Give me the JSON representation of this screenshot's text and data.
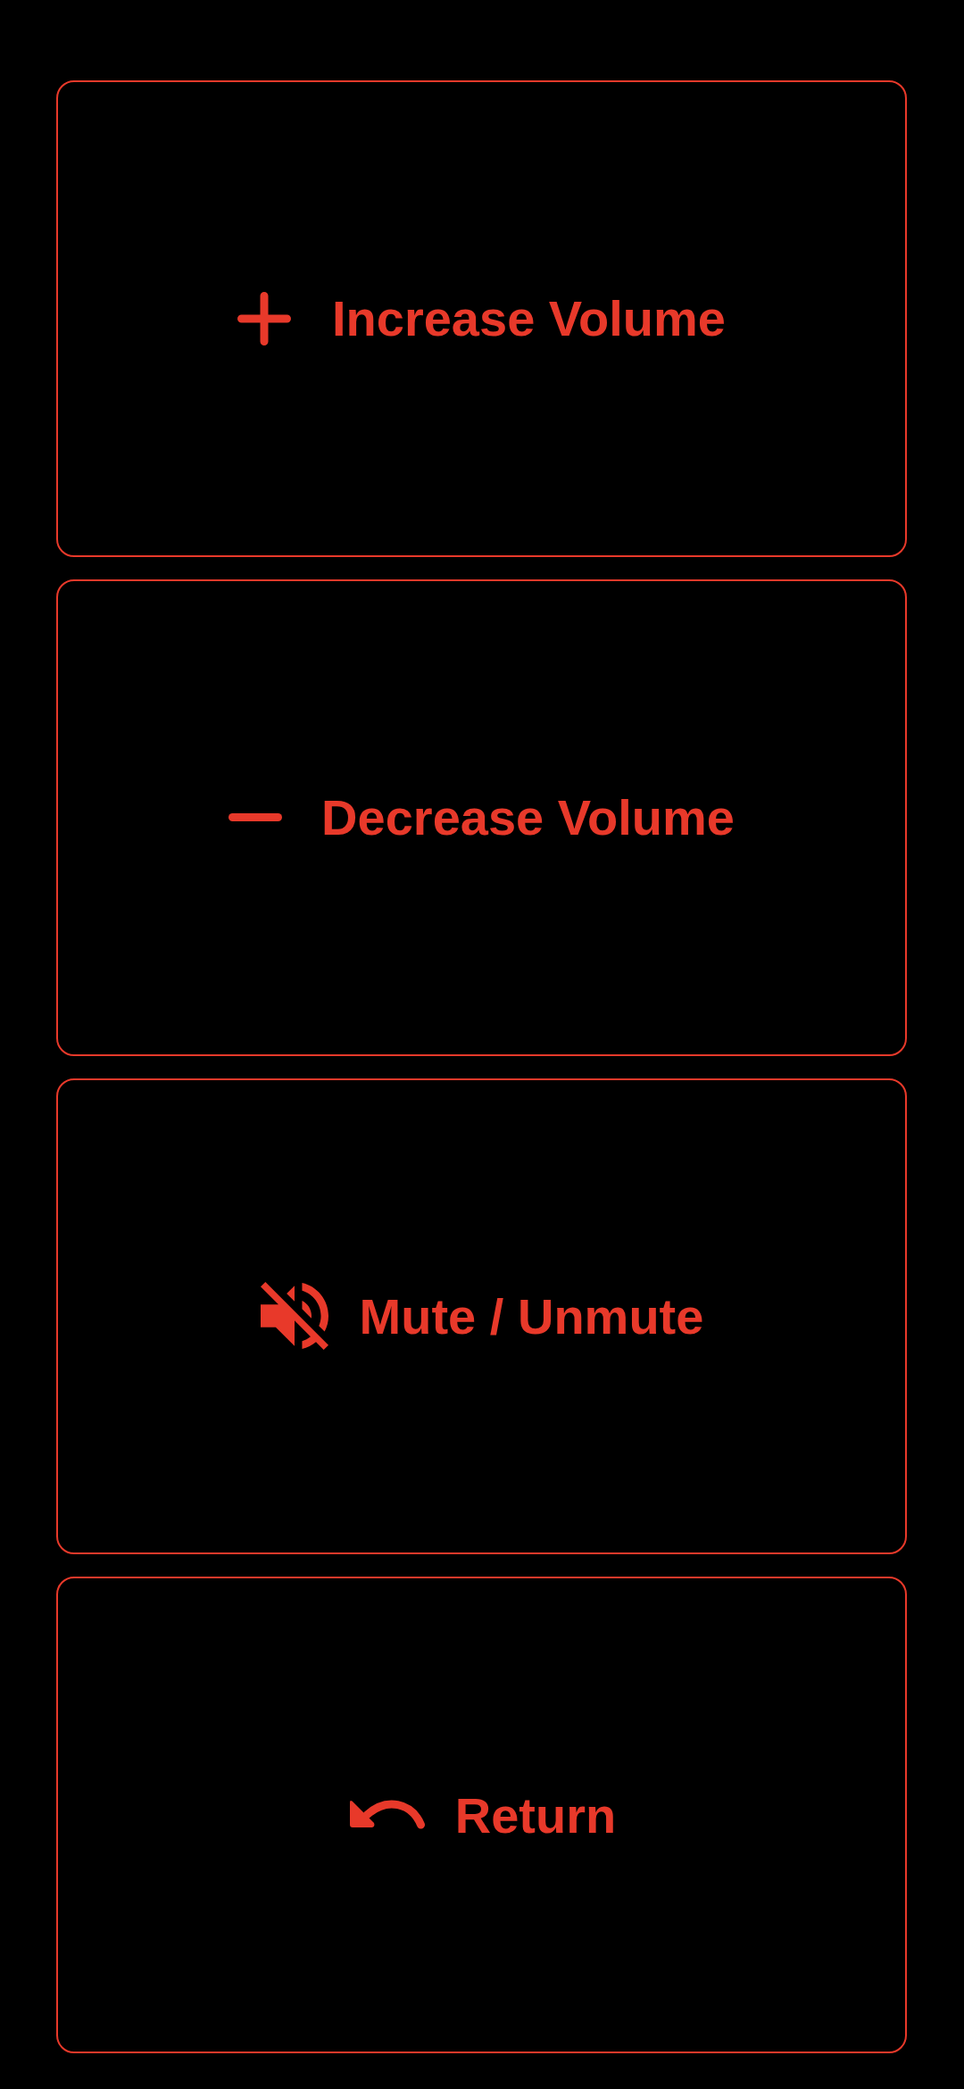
{
  "buttons": [
    {
      "kind": "plus",
      "label": "Increase Volume"
    },
    {
      "kind": "minus",
      "label": "Decrease Volume"
    },
    {
      "kind": "mute",
      "label": "Mute / Unmute"
    },
    {
      "kind": "undo",
      "label": "Return"
    }
  ]
}
